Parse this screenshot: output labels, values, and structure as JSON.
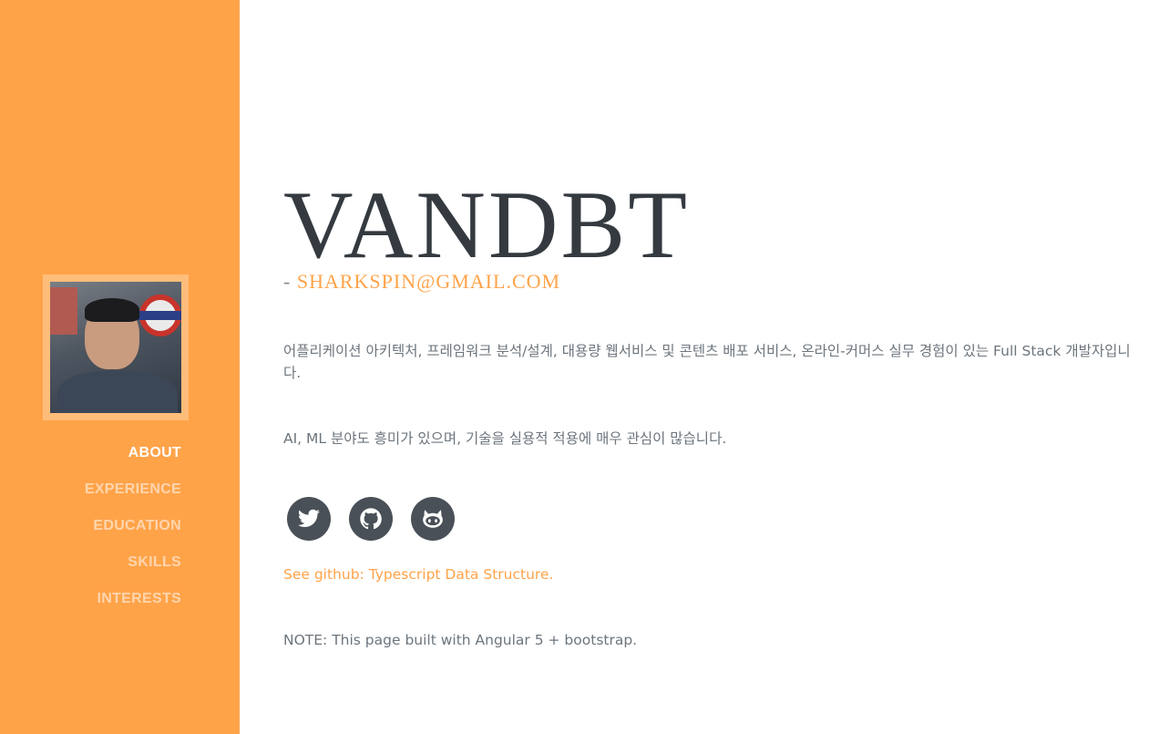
{
  "colors": {
    "sidebar": "#ffa349",
    "accent": "#ffa349",
    "heading": "#343a40",
    "text": "#6c757d",
    "social_bg": "#495057"
  },
  "sidebar": {
    "nav": [
      {
        "label": "ABOUT",
        "active": true
      },
      {
        "label": "EXPERIENCE",
        "active": false
      },
      {
        "label": "EDUCATION",
        "active": false
      },
      {
        "label": "SKILLS",
        "active": false
      },
      {
        "label": "INTERESTS",
        "active": false
      }
    ]
  },
  "about": {
    "title": "VANDBT",
    "dash": "- ",
    "email": "SHARKSPIN@GMAIL.COM",
    "paragraph1": "어플리케이션 아키텍처, 프레임워크 분석/설계, 대용량 웹서비스 및 콘텐츠 배포 서비스, 온라인-커머스 실무 경험이 있는 Full Stack 개발자입니다.",
    "paragraph2": "AI, ML 분야도 흥미가 있으며, 기술을 실용적 적용에 매우 관심이 많습니다.",
    "social": [
      {
        "icon": "twitter-icon"
      },
      {
        "icon": "github-icon"
      },
      {
        "icon": "github-cat-icon"
      }
    ],
    "link": "See github: Typescript Data Structure.",
    "note": "NOTE: This page built with Angular 5 + bootstrap."
  }
}
